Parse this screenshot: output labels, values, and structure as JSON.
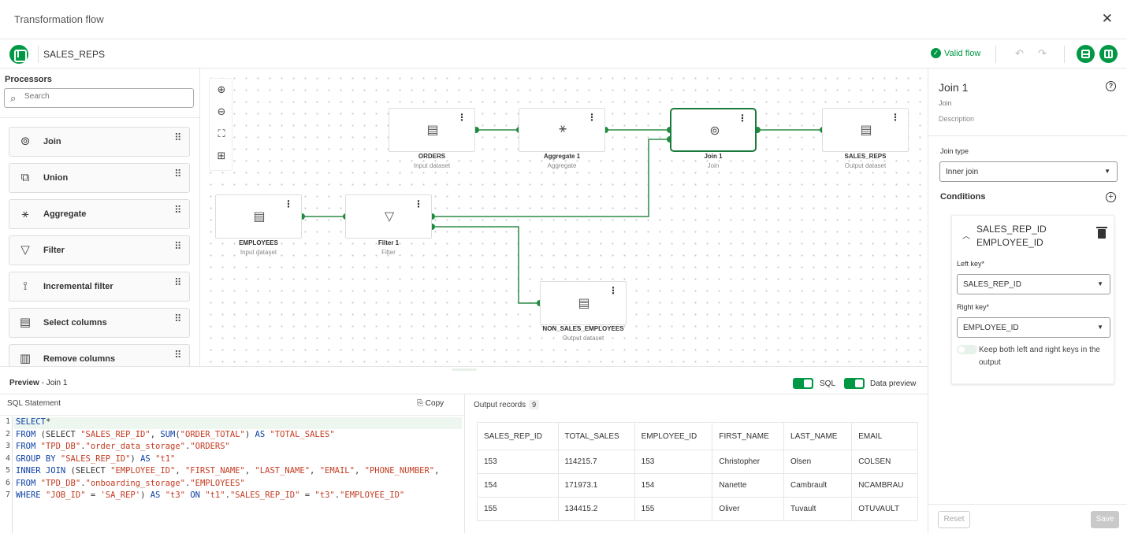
{
  "window": {
    "title": "Transformation flow"
  },
  "toolbar": {
    "flow_name": "SALES_REPS",
    "status": "Valid flow"
  },
  "processors": {
    "heading": "Processors",
    "search_placeholder": "Search",
    "items": [
      {
        "label": "Join",
        "icon": "join-icon",
        "glyph": "⊚"
      },
      {
        "label": "Union",
        "icon": "union-icon",
        "glyph": "⧉"
      },
      {
        "label": "Aggregate",
        "icon": "aggregate-icon",
        "glyph": "⚹"
      },
      {
        "label": "Filter",
        "icon": "filter-icon",
        "glyph": "▽"
      },
      {
        "label": "Incremental filter",
        "icon": "incremental-filter-icon",
        "glyph": "⟟"
      },
      {
        "label": "Select columns",
        "icon": "select-columns-icon",
        "glyph": "▤"
      },
      {
        "label": "Remove columns",
        "icon": "remove-columns-icon",
        "glyph": "▥"
      }
    ]
  },
  "nodes": {
    "orders": {
      "label": "ORDERS",
      "sub": "Input dataset"
    },
    "aggregate": {
      "label": "Aggregate 1",
      "sub": "Aggregate"
    },
    "join": {
      "label": "Join 1",
      "sub": "Join"
    },
    "sales_reps": {
      "label": "SALES_REPS",
      "sub": "Output dataset"
    },
    "employees": {
      "label": "EMPLOYEES",
      "sub": "Input dataset"
    },
    "filter": {
      "label": "Filter 1",
      "sub": "Filter"
    },
    "non_sales": {
      "label": "NON_SALES_EMPLOYEES",
      "sub": "Output dataset"
    }
  },
  "properties": {
    "title": "Join 1",
    "subtitle": "Join",
    "description": "Description",
    "join_type_label": "Join type",
    "join_type": "Inner join",
    "conditions_label": "Conditions",
    "condition": {
      "key1": "SALES_REP_ID",
      "key2": "EMPLOYEE_ID",
      "left_label": "Left key*",
      "left_value": "SALES_REP_ID",
      "right_label": "Right key*",
      "right_value": "EMPLOYEE_ID",
      "keep_label": "Keep both left and right keys in the output"
    },
    "reset": "Reset",
    "save": "Save"
  },
  "preview": {
    "title_bold": "Preview",
    "title_rest": " - Join 1",
    "sql_toggle": "SQL",
    "data_toggle": "Data preview",
    "sql_heading": "SQL Statement",
    "copy": "Copy",
    "output_heading": "Output records",
    "output_count": "9",
    "columns": [
      "SALES_REP_ID",
      "TOTAL_SALES",
      "EMPLOYEE_ID",
      "FIRST_NAME",
      "LAST_NAME",
      "EMAIL"
    ],
    "rows": [
      [
        "153",
        "114215.7",
        "153",
        "Christopher",
        "Olsen",
        "COLSEN"
      ],
      [
        "154",
        "171973.1",
        "154",
        "Nanette",
        "Cambrault",
        "NCAMBRAU"
      ],
      [
        "155",
        "134415.2",
        "155",
        "Oliver",
        "Tuvault",
        "OTUVAULT"
      ]
    ]
  },
  "sql_lines": [
    [
      [
        "kw",
        "SELECT"
      ],
      [
        "",
        "*"
      ]
    ],
    [
      [
        "kw",
        "FROM"
      ],
      [
        "",
        " (SELECT "
      ],
      [
        "st",
        "\"SALES_REP_ID\""
      ],
      [
        "",
        ", "
      ],
      [
        "kw",
        "SUM"
      ],
      [
        "",
        "("
      ],
      [
        "st",
        "\"ORDER_TOTAL\""
      ],
      [
        "",
        ") "
      ],
      [
        "kw",
        "AS"
      ],
      [
        "",
        " "
      ],
      [
        "st",
        "\"TOTAL_SALES\""
      ]
    ],
    [
      [
        "kw",
        "FROM"
      ],
      [
        "",
        " "
      ],
      [
        "st",
        "\"TPD_DB\""
      ],
      [
        "",
        "."
      ],
      [
        "st",
        "\"order_data_storage\""
      ],
      [
        "",
        "."
      ],
      [
        "st",
        "\"ORDERS\""
      ]
    ],
    [
      [
        "kw",
        "GROUP BY"
      ],
      [
        "",
        " "
      ],
      [
        "st",
        "\"SALES_REP_ID\""
      ],
      [
        "",
        ") "
      ],
      [
        "kw",
        "AS"
      ],
      [
        "",
        " "
      ],
      [
        "st",
        "\"t1\""
      ]
    ],
    [
      [
        "kw",
        "INNER JOIN"
      ],
      [
        "",
        " (SELECT "
      ],
      [
        "st",
        "\"EMPLOYEE_ID\""
      ],
      [
        "",
        ", "
      ],
      [
        "st",
        "\"FIRST_NAME\""
      ],
      [
        "",
        ", "
      ],
      [
        "st",
        "\"LAST_NAME\""
      ],
      [
        "",
        ", "
      ],
      [
        "st",
        "\"EMAIL\""
      ],
      [
        "",
        ", "
      ],
      [
        "st",
        "\"PHONE_NUMBER\""
      ],
      [
        "",
        ","
      ]
    ],
    [
      [
        "kw",
        "FROM"
      ],
      [
        "",
        " "
      ],
      [
        "st",
        "\"TPD_DB\""
      ],
      [
        "",
        "."
      ],
      [
        "st",
        "\"onboarding_storage\""
      ],
      [
        "",
        "."
      ],
      [
        "st",
        "\"EMPLOYEES\""
      ]
    ],
    [
      [
        "kw",
        "WHERE"
      ],
      [
        "",
        " "
      ],
      [
        "st",
        "\"JOB_ID\""
      ],
      [
        "",
        " = "
      ],
      [
        "st",
        "'SA_REP'"
      ],
      [
        "",
        ") "
      ],
      [
        "kw",
        "AS"
      ],
      [
        "",
        " "
      ],
      [
        "st",
        "\"t3\""
      ],
      [
        "",
        " "
      ],
      [
        "kw",
        "ON"
      ],
      [
        "",
        " "
      ],
      [
        "st",
        "\"t1\""
      ],
      [
        "",
        "."
      ],
      [
        "st",
        "\"SALES_REP_ID\""
      ],
      [
        "",
        " = "
      ],
      [
        "st",
        "\"t3\""
      ],
      [
        "",
        "."
      ],
      [
        "st",
        "\"EMPLOYEE_ID\""
      ]
    ]
  ],
  "colors": {
    "accent": "#009845",
    "keyword": "#0b3fa6",
    "string": "#c43b22"
  }
}
